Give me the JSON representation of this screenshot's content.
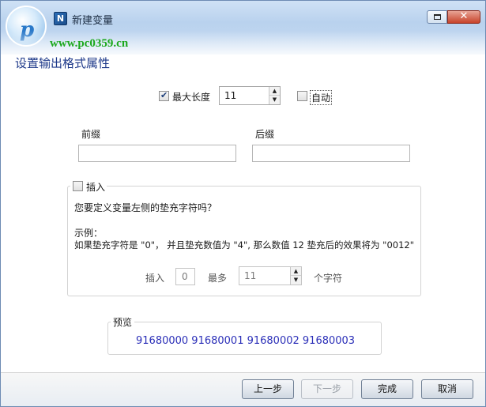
{
  "window": {
    "title": "新建变量",
    "app_icon_glyph": "N",
    "watermark_url": "www.pc0359.cn",
    "logo_glyph": "p",
    "close_glyph": "✕"
  },
  "heading": "设置输出格式属性",
  "max_length": {
    "label": "最大长度",
    "checked": true,
    "value": "11",
    "auto_label": "自动",
    "auto_checked": false
  },
  "prefix": {
    "label": "前缀",
    "value": ""
  },
  "suffix": {
    "label": "后缀",
    "value": ""
  },
  "padding": {
    "legend": "插入",
    "checked": false,
    "question": "您要定义变量左侧的垫充字符吗？",
    "example_title": "示例：",
    "example_text": "如果垫充字符是 \"0\"， 并且垫充数值为 \"4\", 那么数值 12 垫充后的效果将为 \"0012\"",
    "insert_label": "插入",
    "insert_value": "0",
    "max_label": "最多",
    "max_value": "11",
    "unit_label": "个字符"
  },
  "preview": {
    "legend": "预览",
    "text": "91680000 91680001 91680002 91680003"
  },
  "buttons": {
    "back": "上一步",
    "next": "下一步",
    "finish": "完成",
    "cancel": "取消"
  },
  "icons": {
    "app": "app-icon",
    "maximize": "maximize-icon",
    "close": "close-icon",
    "spin_up": "spin-up-arrow-icon",
    "spin_down": "spin-down-arrow-icon"
  }
}
